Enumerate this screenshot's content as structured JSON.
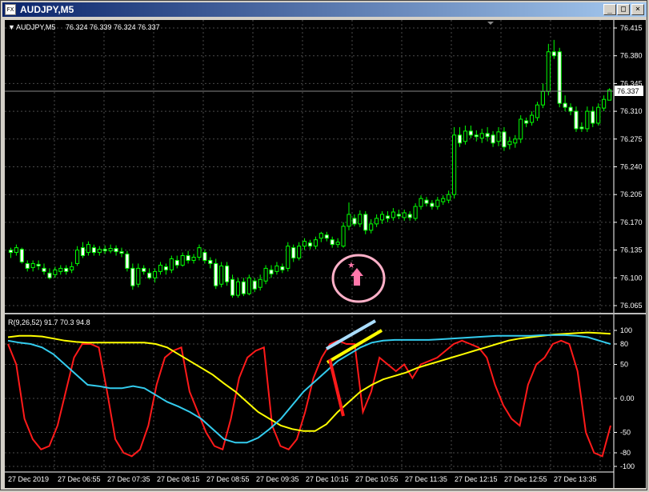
{
  "window": {
    "title": "AUDJPY,M5",
    "icon_label": "FX",
    "buttons": {
      "minimize": "_",
      "maximize": "□",
      "close": "×"
    }
  },
  "header": {
    "symbol": "AUDJPY,M5",
    "ohlc": "76.324 76.339 76.324 76.337"
  },
  "indicator": {
    "label": "R(9,26,52) 91.7 70.3 94.8"
  },
  "colors": {
    "background": "#000000",
    "grid": "#4a4a4a",
    "axis_text": "#ffffff",
    "candle": "#00ff00",
    "red_line": "#ff1a1a",
    "yellow_line": "#ffff00",
    "cyan_line": "#33ccee",
    "annotation_pink": "#ff77aa",
    "annotation_light_blue": "#aaddff"
  },
  "price_axis": {
    "labels": [
      "76.415",
      "76.380",
      "76.345",
      "76.310",
      "76.275",
      "76.240",
      "76.205",
      "76.170",
      "76.135",
      "76.100",
      "76.065"
    ],
    "current": "76.337"
  },
  "osc_axis": {
    "labels": [
      "100",
      "80",
      "50",
      "0.00",
      "-50",
      "-80",
      "-100"
    ]
  },
  "time_axis": {
    "labels": [
      "27 Dec 2019",
      "27 Dec 06:55",
      "27 Dec 07:35",
      "27 Dec 08:15",
      "27 Dec 08:55",
      "27 Dec 09:35",
      "27 Dec 10:15",
      "27 Dec 10:55",
      "27 Dec 11:35",
      "27 Dec 12:15",
      "27 Dec 12:55",
      "27 Dec 13:35"
    ]
  },
  "chart_data": {
    "type": "candlestick",
    "symbol": "AUDJPY",
    "timeframe": "M5",
    "ylim": [
      76.065,
      76.415
    ],
    "candles": [
      [
        76.135,
        76.132,
        76.138,
        76.125
      ],
      [
        76.132,
        76.138,
        76.142,
        76.128
      ],
      [
        76.136,
        76.12,
        76.138,
        76.118
      ],
      [
        76.118,
        76.112,
        76.122,
        76.108
      ],
      [
        76.113,
        76.118,
        76.122,
        76.108
      ],
      [
        76.117,
        76.115,
        76.122,
        76.11
      ],
      [
        76.112,
        76.108,
        76.118,
        76.104
      ],
      [
        76.106,
        76.1,
        76.112,
        76.098
      ],
      [
        76.104,
        76.11,
        76.114,
        76.1
      ],
      [
        76.108,
        76.112,
        76.116,
        76.104
      ],
      [
        76.112,
        76.108,
        76.116,
        76.104
      ],
      [
        76.11,
        76.114,
        76.12,
        76.106
      ],
      [
        76.118,
        76.135,
        76.14,
        76.115
      ],
      [
        76.138,
        76.128,
        76.145,
        76.125
      ],
      [
        76.132,
        76.142,
        76.146,
        76.128
      ],
      [
        76.138,
        76.132,
        76.142,
        76.128
      ],
      [
        76.132,
        76.136,
        76.14,
        76.128
      ],
      [
        76.136,
        76.134,
        76.141,
        76.13
      ],
      [
        76.134,
        76.137,
        76.142,
        76.131
      ],
      [
        76.137,
        76.133,
        76.141,
        76.128
      ],
      [
        76.133,
        76.131,
        76.138,
        76.126
      ],
      [
        76.13,
        76.112,
        76.134,
        76.108
      ],
      [
        76.112,
        76.09,
        76.118,
        76.085
      ],
      [
        76.092,
        76.112,
        76.118,
        76.088
      ],
      [
        76.112,
        76.108,
        76.116,
        76.104
      ],
      [
        76.106,
        76.1,
        76.112,
        76.098
      ],
      [
        76.1,
        76.108,
        76.112,
        76.094
      ],
      [
        76.108,
        76.116,
        76.12,
        76.104
      ],
      [
        76.114,
        76.11,
        76.118,
        76.104
      ],
      [
        76.11,
        76.124,
        76.128,
        76.106
      ],
      [
        76.122,
        76.116,
        76.128,
        76.112
      ],
      [
        76.116,
        76.128,
        76.132,
        76.114
      ],
      [
        76.128,
        76.122,
        76.134,
        76.118
      ],
      [
        76.122,
        76.126,
        76.13,
        76.118
      ],
      [
        76.126,
        76.138,
        76.142,
        76.122
      ],
      [
        76.132,
        76.122,
        76.136,
        76.118
      ],
      [
        76.122,
        76.118,
        76.126,
        76.112
      ],
      [
        76.118,
        76.09,
        76.124,
        76.086
      ],
      [
        76.092,
        76.115,
        76.12,
        76.088
      ],
      [
        76.115,
        76.095,
        76.12,
        76.09
      ],
      [
        76.098,
        76.078,
        76.104,
        76.075
      ],
      [
        76.078,
        76.095,
        76.1,
        76.075
      ],
      [
        76.095,
        76.08,
        76.1,
        76.077
      ],
      [
        76.08,
        76.1,
        76.104,
        76.078
      ],
      [
        76.096,
        76.086,
        76.1,
        76.082
      ],
      [
        76.088,
        76.098,
        76.104,
        76.084
      ],
      [
        76.096,
        76.112,
        76.116,
        76.092
      ],
      [
        76.11,
        76.105,
        76.116,
        76.1
      ],
      [
        76.108,
        76.115,
        76.12,
        76.104
      ],
      [
        76.114,
        76.11,
        76.118,
        76.106
      ],
      [
        76.112,
        76.14,
        76.145,
        76.108
      ],
      [
        76.138,
        76.125,
        76.142,
        76.12
      ],
      [
        76.125,
        76.14,
        76.145,
        76.122
      ],
      [
        76.14,
        76.146,
        76.15,
        76.135
      ],
      [
        76.144,
        76.14,
        76.148,
        76.136
      ],
      [
        76.14,
        76.148,
        76.152,
        76.136
      ],
      [
        76.15,
        76.156,
        76.158,
        76.145
      ],
      [
        76.154,
        76.15,
        76.158,
        76.146
      ],
      [
        76.148,
        76.142,
        76.152,
        76.138
      ],
      [
        76.142,
        76.145,
        76.15,
        76.138
      ],
      [
        76.14,
        76.165,
        76.17,
        76.138
      ],
      [
        76.165,
        76.18,
        76.195,
        76.16
      ],
      [
        76.175,
        76.168,
        76.18,
        76.165
      ],
      [
        76.168,
        76.18,
        76.185,
        76.164
      ],
      [
        76.18,
        76.16,
        76.184,
        76.155
      ],
      [
        76.16,
        76.168,
        76.174,
        76.156
      ],
      [
        76.168,
        76.175,
        76.18,
        76.164
      ],
      [
        76.173,
        76.18,
        76.184,
        76.168
      ],
      [
        76.178,
        76.175,
        76.184,
        76.17
      ],
      [
        76.176,
        76.183,
        76.188,
        76.172
      ],
      [
        76.18,
        76.178,
        76.186,
        76.174
      ],
      [
        76.176,
        76.182,
        76.186,
        76.172
      ],
      [
        76.18,
        76.176,
        76.184,
        76.172
      ],
      [
        76.175,
        76.19,
        76.194,
        76.172
      ],
      [
        76.19,
        76.2,
        76.204,
        76.186
      ],
      [
        76.198,
        76.194,
        76.202,
        76.19
      ],
      [
        76.194,
        76.19,
        76.198,
        76.186
      ],
      [
        76.19,
        76.198,
        76.202,
        76.186
      ],
      [
        76.196,
        76.2,
        76.204,
        76.192
      ],
      [
        76.198,
        76.205,
        76.21,
        76.194
      ],
      [
        76.205,
        76.28,
        76.29,
        76.2
      ],
      [
        76.28,
        76.27,
        76.29,
        76.265
      ],
      [
        76.272,
        76.285,
        76.292,
        76.268
      ],
      [
        76.285,
        76.28,
        76.292,
        76.276
      ],
      [
        76.28,
        76.278,
        76.286,
        76.272
      ],
      [
        76.276,
        76.282,
        76.288,
        76.27
      ],
      [
        76.282,
        76.278,
        76.29,
        76.272
      ],
      [
        76.28,
        76.27,
        76.285,
        76.265
      ],
      [
        76.272,
        76.284,
        76.29,
        76.266
      ],
      [
        76.284,
        76.265,
        76.29,
        76.26
      ],
      [
        76.268,
        76.272,
        76.278,
        76.262
      ],
      [
        76.27,
        76.275,
        76.28,
        76.264
      ],
      [
        76.275,
        76.3,
        76.305,
        76.27
      ],
      [
        76.298,
        76.295,
        76.302,
        76.29
      ],
      [
        76.296,
        76.305,
        76.31,
        76.292
      ],
      [
        76.302,
        76.318,
        76.322,
        76.298
      ],
      [
        76.318,
        76.335,
        76.345,
        76.314
      ],
      [
        76.335,
        76.385,
        76.395,
        76.33
      ],
      [
        76.385,
        76.38,
        76.4,
        76.376
      ],
      [
        76.385,
        76.32,
        76.39,
        76.315
      ],
      [
        76.32,
        76.315,
        76.33,
        76.31
      ],
      [
        76.315,
        76.31,
        76.32,
        76.305
      ],
      [
        76.31,
        76.288,
        76.316,
        76.284
      ],
      [
        76.29,
        76.288,
        76.296,
        76.284
      ],
      [
        76.288,
        76.31,
        76.316,
        76.284
      ],
      [
        76.31,
        76.295,
        76.316,
        76.29
      ],
      [
        76.295,
        76.315,
        76.32,
        76.292
      ],
      [
        76.314,
        76.325,
        76.33,
        76.31
      ],
      [
        76.324,
        76.337,
        76.339,
        76.324
      ]
    ],
    "oscillator": {
      "range": [
        -100,
        100
      ],
      "levels": [
        100,
        80,
        50,
        0,
        -50,
        -80,
        -100
      ],
      "series": [
        {
          "color": "red",
          "values": [
            80,
            50,
            -30,
            -60,
            -75,
            -70,
            -40,
            10,
            60,
            80,
            80,
            75,
            10,
            -60,
            -80,
            -85,
            -75,
            -40,
            20,
            60,
            70,
            75,
            10,
            -20,
            -50,
            -70,
            -75,
            -30,
            30,
            60,
            70,
            75,
            -40,
            -70,
            -75,
            -60,
            -20,
            30,
            60,
            80,
            85,
            80,
            80,
            -20,
            10,
            60,
            50,
            40,
            50,
            30,
            50,
            55,
            60,
            70,
            80,
            85,
            80,
            75,
            60,
            20,
            -10,
            -30,
            -40,
            20,
            50,
            60,
            80,
            85,
            80,
            40,
            -50,
            -80,
            -85,
            -40
          ]
        },
        {
          "color": "yellow",
          "values": [
            90,
            92,
            92,
            91,
            88,
            85,
            83,
            82,
            82,
            82,
            82,
            82,
            82,
            80,
            75,
            65,
            55,
            45,
            35,
            22,
            10,
            -5,
            -20,
            -30,
            -40,
            -45,
            -48,
            -48,
            -38,
            -20,
            -5,
            10,
            20,
            28,
            33,
            38,
            45,
            50,
            55,
            60,
            65,
            70,
            75,
            80,
            85,
            88,
            90,
            92,
            94,
            95,
            96,
            97,
            96,
            95
          ]
        },
        {
          "color": "cyan",
          "values": [
            85,
            82,
            80,
            75,
            65,
            50,
            35,
            20,
            18,
            15,
            15,
            18,
            15,
            5,
            -5,
            -12,
            -20,
            -30,
            -45,
            -60,
            -65,
            -65,
            -58,
            -45,
            -30,
            -10,
            10,
            25,
            40,
            55,
            65,
            75,
            82,
            85,
            86,
            86,
            86,
            86,
            87,
            88,
            89,
            90,
            91,
            92,
            92,
            92,
            92,
            93,
            93,
            93,
            92,
            90,
            85,
            80
          ]
        }
      ]
    }
  }
}
